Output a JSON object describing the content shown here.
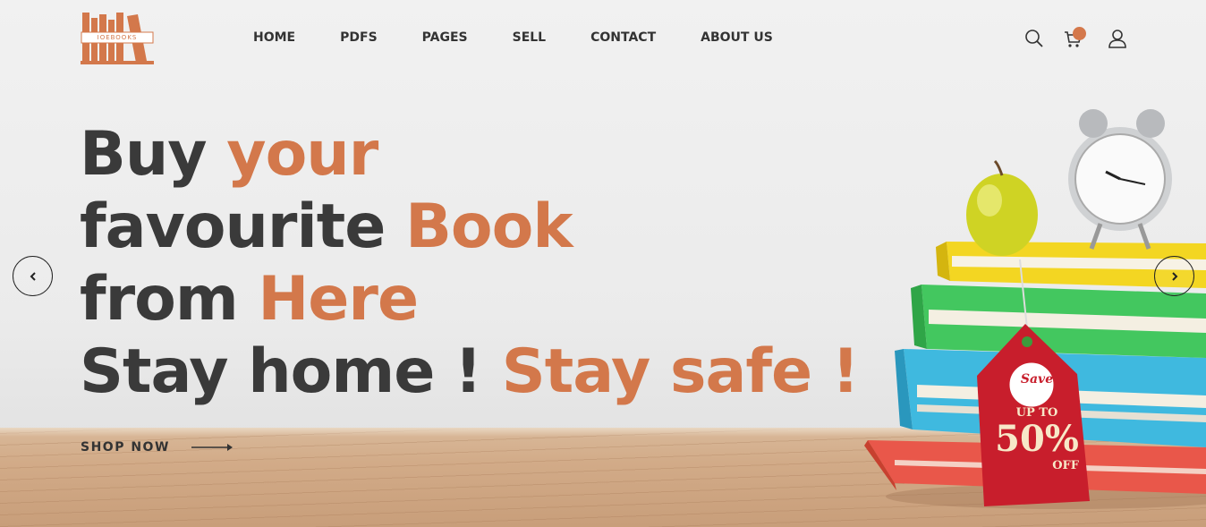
{
  "brand": {
    "logo_text": "IOEBOOKS",
    "accent_color": "#d3784b"
  },
  "nav": {
    "items": [
      {
        "label": "HOME"
      },
      {
        "label": "PDFS"
      },
      {
        "label": "PAGES"
      },
      {
        "label": "SELL"
      },
      {
        "label": "CONTACT"
      },
      {
        "label": "ABOUT US"
      }
    ]
  },
  "header_icons": {
    "search": "search-icon",
    "cart": "cart-icon",
    "account": "user-icon"
  },
  "hero": {
    "line1": {
      "dark": "Buy ",
      "accent": "your"
    },
    "line2": {
      "dark": "favourite ",
      "accent": "Book"
    },
    "line3": {
      "dark": "from ",
      "accent": "Here"
    },
    "line4": {
      "dark": "Stay home ! ",
      "accent": "Stay safe !"
    },
    "cta_label": "SHOP NOW"
  },
  "promo_tag": {
    "save": "Save",
    "up_to": "UP TO",
    "percent": "50%",
    "off": "OFF"
  },
  "slider": {
    "prev_icon": "chevron-left-icon",
    "next_icon": "chevron-right-icon"
  }
}
